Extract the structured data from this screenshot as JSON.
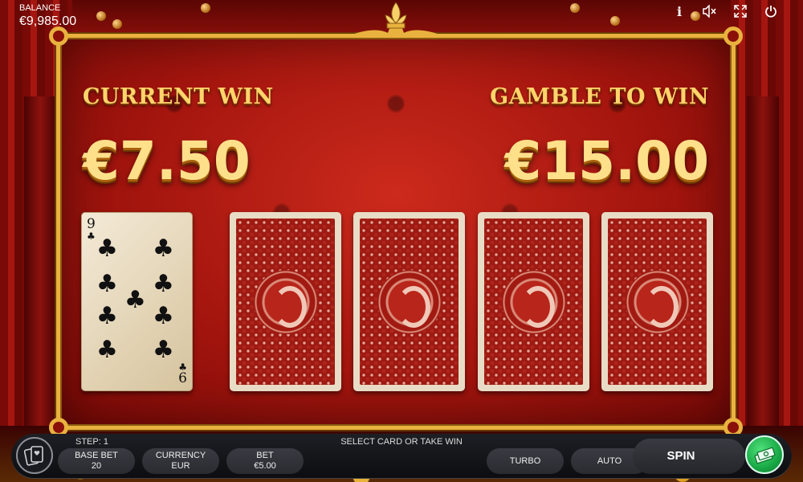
{
  "header": {
    "balance_label": "BALANCE",
    "balance_value": "€9,985.00",
    "icons": [
      "info-icon",
      "sound-off-icon",
      "fullscreen-icon",
      "power-icon"
    ],
    "info_glyph": "i",
    "sound_glyph": "🔇",
    "fullscreen_glyph": "⤢",
    "power_glyph": "⏻"
  },
  "gamble": {
    "current_win_label": "CURRENT WIN",
    "current_win_value": "€7.50",
    "gamble_to_win_label": "GAMBLE TO WIN",
    "gamble_to_win_value": "€15.00",
    "revealed_card": {
      "rank": "9",
      "suit": "♣",
      "bottom_rank": "6"
    },
    "hidden_cards": 4
  },
  "bottom_bar": {
    "step_text": "STEP: 1",
    "prompt_text": "SELECT CARD OR TAKE WIN",
    "base_bet_label": "BASE BET",
    "base_bet_value": "20",
    "currency_label": "CURRENCY",
    "currency_value": "EUR",
    "bet_label": "BET",
    "bet_value": "€5.00",
    "turbo_label": "TURBO",
    "auto_label": "AUTO",
    "spin_label": "SPIN"
  },
  "colors": {
    "gold": "#e9b23e",
    "felt_red": "#a3150e",
    "take_win_green": "#18a845"
  }
}
